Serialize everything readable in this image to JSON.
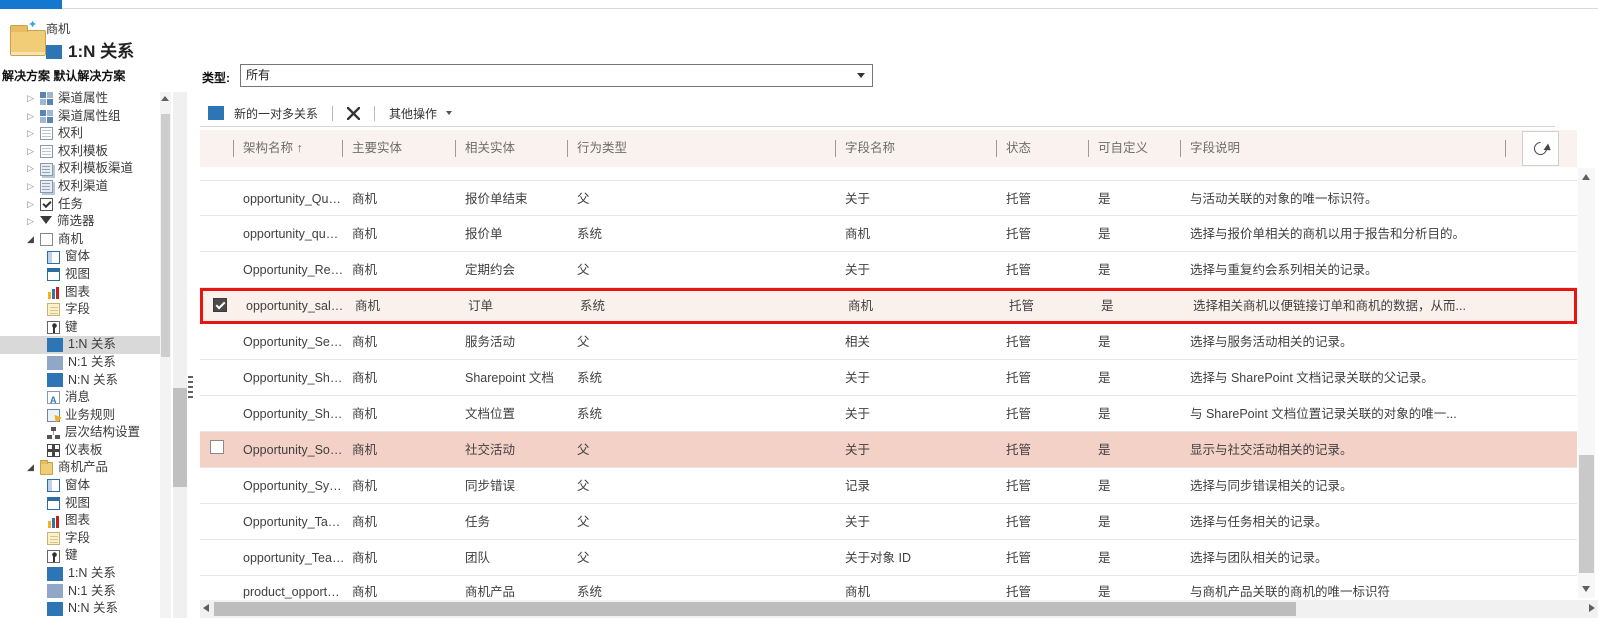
{
  "header": {
    "entity_context": "商机",
    "title": "1:N 关系",
    "solution_breadcrumb": "解决方案 默认解决方案",
    "type_label": "类型:",
    "type_value": "所有"
  },
  "toolbar": {
    "new_relationship": "新的一对多关系",
    "more_actions": "其他操作"
  },
  "sidebar": {
    "items": [
      {
        "label": "渠道属性",
        "depth": 0,
        "state": "collapsed",
        "icon": "grid"
      },
      {
        "label": "渠道属性组",
        "depth": 0,
        "state": "collapsed",
        "icon": "grid"
      },
      {
        "label": "权利",
        "depth": 0,
        "state": "collapsed",
        "icon": "doc"
      },
      {
        "label": "权利模板",
        "depth": 0,
        "state": "collapsed",
        "icon": "doc"
      },
      {
        "label": "权利模板渠道",
        "depth": 0,
        "state": "collapsed",
        "icon": "docstack"
      },
      {
        "label": "权利渠道",
        "depth": 0,
        "state": "collapsed",
        "icon": "docstack"
      },
      {
        "label": "任务",
        "depth": 0,
        "state": "collapsed",
        "icon": "task"
      },
      {
        "label": "筛选器",
        "depth": 0,
        "state": "collapsed",
        "icon": "funnel"
      },
      {
        "label": "商机",
        "depth": 0,
        "state": "expanded",
        "icon": "entity"
      },
      {
        "label": "窗体",
        "depth": 1,
        "state": "leaf",
        "icon": "form"
      },
      {
        "label": "视图",
        "depth": 1,
        "state": "leaf",
        "icon": "view"
      },
      {
        "label": "图表",
        "depth": 1,
        "state": "leaf",
        "icon": "chart"
      },
      {
        "label": "字段",
        "depth": 1,
        "state": "leaf",
        "icon": "field"
      },
      {
        "label": "键",
        "depth": 1,
        "state": "leaf",
        "icon": "key"
      },
      {
        "label": "1:N 关系",
        "depth": 1,
        "state": "leaf",
        "icon": "rel1n",
        "selected": true
      },
      {
        "label": "N:1 关系",
        "depth": 1,
        "state": "leaf",
        "icon": "reln1"
      },
      {
        "label": "N:N 关系",
        "depth": 1,
        "state": "leaf",
        "icon": "relnn"
      },
      {
        "label": "消息",
        "depth": 1,
        "state": "leaf",
        "icon": "message"
      },
      {
        "label": "业务规则",
        "depth": 1,
        "state": "leaf",
        "icon": "bizrule"
      },
      {
        "label": "层次结构设置",
        "depth": 1,
        "state": "leaf",
        "icon": "hierarchy"
      },
      {
        "label": "仪表板",
        "depth": 1,
        "state": "leaf",
        "icon": "dashboard"
      },
      {
        "label": "商机产品",
        "depth": 0,
        "state": "expanded",
        "icon": "folder"
      },
      {
        "label": "窗体",
        "depth": 1,
        "state": "leaf",
        "icon": "form"
      },
      {
        "label": "视图",
        "depth": 1,
        "state": "leaf",
        "icon": "view"
      },
      {
        "label": "图表",
        "depth": 1,
        "state": "leaf",
        "icon": "chart"
      },
      {
        "label": "字段",
        "depth": 1,
        "state": "leaf",
        "icon": "field"
      },
      {
        "label": "键",
        "depth": 1,
        "state": "leaf",
        "icon": "key"
      },
      {
        "label": "1:N 关系",
        "depth": 1,
        "state": "leaf",
        "icon": "rel1n"
      },
      {
        "label": "N:1 关系",
        "depth": 1,
        "state": "leaf",
        "icon": "reln1"
      },
      {
        "label": "N:N 关系",
        "depth": 1,
        "state": "leaf",
        "icon": "relnn"
      }
    ]
  },
  "grid": {
    "columns": [
      "架构名称",
      "主要实体",
      "相关实体",
      "行为类型",
      "字段名称",
      "状态",
      "可自定义",
      "字段说明"
    ],
    "sort_arrow": "↑",
    "rows": [
      {
        "schema_name": "opportunity_QuoteC...",
        "primary_entity": "商机",
        "related_entity": "报价单结束",
        "behavior": "父",
        "field_name": "关于",
        "state": "托管",
        "customizable": "是",
        "description": "与活动关联的对象的唯一标识符。"
      },
      {
        "schema_name": "opportunity_quotes",
        "primary_entity": "商机",
        "related_entity": "报价单",
        "behavior": "系统",
        "field_name": "商机",
        "state": "托管",
        "customizable": "是",
        "description": "选择与报价单相关的商机以用于报告和分析目的。"
      },
      {
        "schema_name": "Opportunity_Recurri...",
        "primary_entity": "商机",
        "related_entity": "定期约会",
        "behavior": "父",
        "field_name": "关于",
        "state": "托管",
        "customizable": "是",
        "description": "选择与重复约会系列相关的记录。"
      },
      {
        "schema_name": "opportunity_sales_o...",
        "primary_entity": "商机",
        "related_entity": "订单",
        "behavior": "系统",
        "field_name": "商机",
        "state": "托管",
        "customizable": "是",
        "description": "选择相关商机以便链接订单和商机的数据，从而...",
        "selected": true
      },
      {
        "schema_name": "Opportunity_Service...",
        "primary_entity": "商机",
        "related_entity": "服务活动",
        "behavior": "父",
        "field_name": "相关",
        "state": "托管",
        "customizable": "是",
        "description": "选择与服务活动相关的记录。"
      },
      {
        "schema_name": "Opportunity_Sharep...",
        "primary_entity": "商机",
        "related_entity": "Sharepoint 文档",
        "behavior": "系统",
        "field_name": "关于",
        "state": "托管",
        "customizable": "是",
        "description": "选择与 SharePoint 文档记录关联的父记录。"
      },
      {
        "schema_name": "Opportunity_Sharep...",
        "primary_entity": "商机",
        "related_entity": "文档位置",
        "behavior": "系统",
        "field_name": "关于",
        "state": "托管",
        "customizable": "是",
        "description": "与 SharePoint 文档位置记录关联的对象的唯一..."
      },
      {
        "schema_name": "Opportunity_SocialA...",
        "primary_entity": "商机",
        "related_entity": "社交活动",
        "behavior": "父",
        "field_name": "关于",
        "state": "托管",
        "customizable": "是",
        "description": "显示与社交活动相关的记录。",
        "highlighted": true
      },
      {
        "schema_name": "Opportunity_SyncErr...",
        "primary_entity": "商机",
        "related_entity": "同步错误",
        "behavior": "父",
        "field_name": "记录",
        "state": "托管",
        "customizable": "是",
        "description": "选择与同步错误相关的记录。"
      },
      {
        "schema_name": "Opportunity_Tasks",
        "primary_entity": "商机",
        "related_entity": "任务",
        "behavior": "父",
        "field_name": "关于",
        "state": "托管",
        "customizable": "是",
        "description": "选择与任务相关的记录。"
      },
      {
        "schema_name": "opportunity_Teams",
        "primary_entity": "商机",
        "related_entity": "团队",
        "behavior": "父",
        "field_name": "关于对象 ID",
        "state": "托管",
        "customizable": "是",
        "description": "选择与团队相关的记录。"
      },
      {
        "schema_name": "product_opportuniti...",
        "primary_entity": "商机",
        "related_entity": "商机产品",
        "behavior": "系统",
        "field_name": "商机",
        "state": "托管",
        "customizable": "是",
        "description": "与商机产品关联的商机的唯一标识符",
        "clipped": true
      }
    ]
  }
}
